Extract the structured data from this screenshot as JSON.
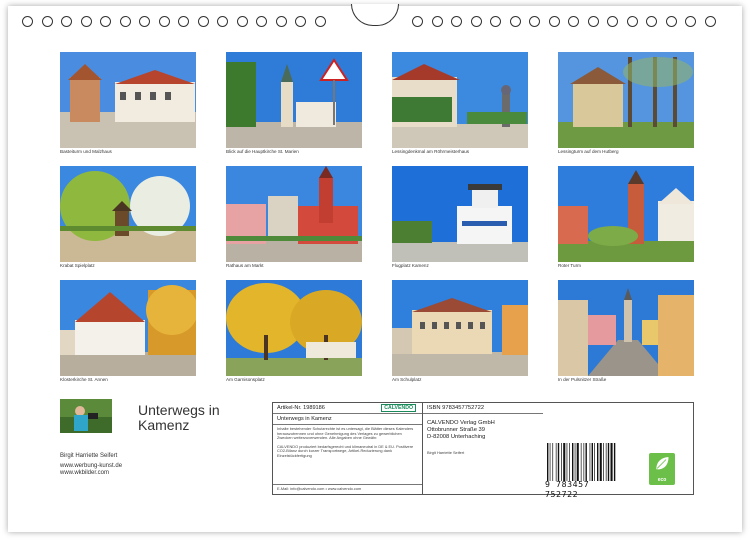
{
  "photos": [
    {
      "caption": "Basteiturm und Malzhaus"
    },
    {
      "caption": "Blick auf die Hauptkirche St. Marien"
    },
    {
      "caption": "Lessingdenkmal am Röhrmeisterhaus"
    },
    {
      "caption": "Lessingturm auf dem Hutberg"
    },
    {
      "caption": "Krabat Spielplatz"
    },
    {
      "caption": "Rathaus am Markt"
    },
    {
      "caption": "Flugplatz Kamenz"
    },
    {
      "caption": "Roter Turm"
    },
    {
      "caption": "Klosterkirche St. Annen"
    },
    {
      "caption": "Am Garnisonsplatz"
    },
    {
      "caption": "Am Schulplatz"
    },
    {
      "caption": "In der Pulsnitzer Straße"
    }
  ],
  "title": "Unterwegs in Kamenz",
  "author": {
    "name": "Birgit Harriette Seifert",
    "web1": "www.werbung-kunst.de",
    "web2": "www.wkbilder.com"
  },
  "info": {
    "article": "Artikel-Nr. 1989186",
    "logo_text": "CALVENDO",
    "product_title": "Unterwegs in Kamenz",
    "legal1": "Inhalte bestehender Schutzrechte ist es untersagt, die Blätter dieses Kalenders herauszutrennen und ohne Genehmigung des Verlages zu gewerblichen Zwecken weiterzuverwenden. Alle Angaben ohne Gewähr.",
    "legal2": "CALVENDO produziert bedarfsgerecht und klimaneutral in DE & EU. Positivere CO2-Bilanz durch kurzer Transportwege, Artikel-Reduzierung dank Einzelstückfertigung",
    "email": "E-Mail: info@calvendo.com • www.calvendo.com",
    "isbn": "ISBN 9783457752722",
    "publisher1": "CALVENDO Verlag GmbH",
    "publisher2": "Ottobrunner Straße 39",
    "publisher3": "D-82008 Unterhaching",
    "author_small": "Birgit Harriette Seifert",
    "barcode_digits": "9 783457 752722",
    "eco_label": "eco"
  }
}
